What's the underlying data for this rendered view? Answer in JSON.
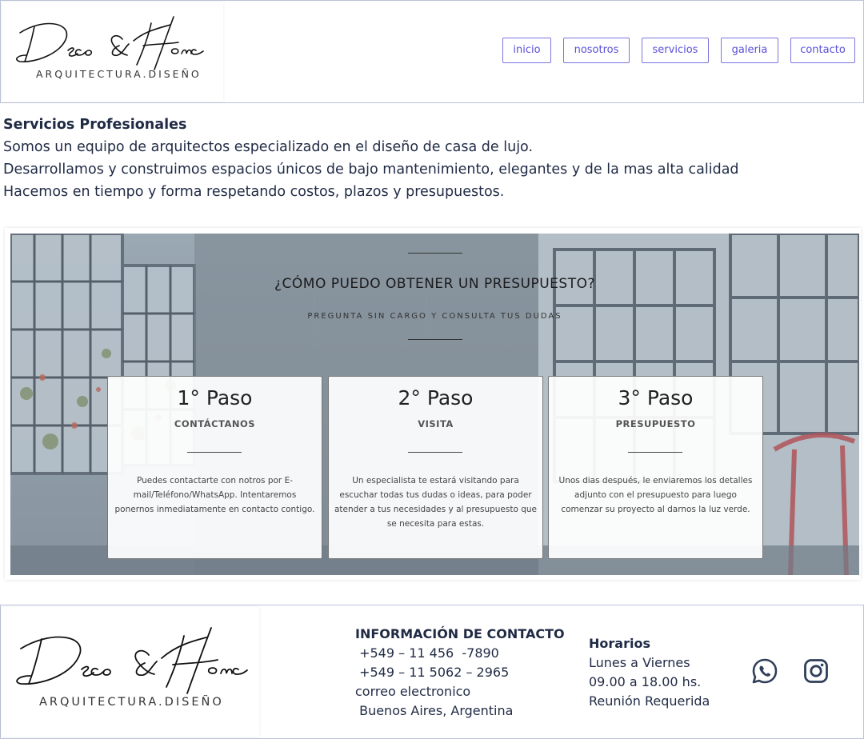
{
  "brand": {
    "logo_script": "Deco & Home",
    "logo_sub": "ARQUITECTURA.DISEÑO"
  },
  "nav": {
    "items": [
      {
        "label": "inicio"
      },
      {
        "label": "nosotros"
      },
      {
        "label": "servicios"
      },
      {
        "label": "galeria"
      },
      {
        "label": "contacto"
      }
    ]
  },
  "intro": {
    "heading": "Servicios Profesionales",
    "lines": [
      "Somos un equipo de arquitectos especializado en el diseño de casa de lujo.",
      "Desarrollamos y construimos espacios únicos de bajo mantenimiento, elegantes y de la mas alta calidad",
      "Hacemos en tiempo y forma respetando costos, plazos y presupuestos."
    ]
  },
  "banner": {
    "title": "¿CÓMO PUEDO OBTENER UN PRESUPUESTO?",
    "subtitle": "PREGUNTA SIN CARGO Y CONSULTA TUS DUDAS",
    "steps": [
      {
        "title": "1° Paso",
        "subtitle": "CONTÁCTANOS",
        "text": "Puedes contactarte con notros por E-mail/Teléfono/WhatsApp. Intentaremos ponernos inmediatamente en contacto contigo."
      },
      {
        "title": "2° Paso",
        "subtitle": "VISITA",
        "text": "Un especialista te estará visitando para escuchar todas tus dudas o ideas, para poder atender a tus necesidades y al presupuesto que se necesita para estas."
      },
      {
        "title": "3° Paso",
        "subtitle": "PRESUPUESTO",
        "text": "Unos dias después, le enviaremos los detalles adjunto con el presupuesto para luego comenzar su proyecto al darnos la luz verde."
      }
    ]
  },
  "footer": {
    "contact": {
      "heading": "INFORMACIÓN DE CONTACTO",
      "phone1": " +549 – 11 456  -7890",
      "phone2": " +549 – 11 5062 – 2965",
      "email": "correo electronico",
      "location": " Buenos Aires, Argentina"
    },
    "hours": {
      "heading": "Horarios",
      "days": "Lunes a Viernes",
      "time": "09.00 a 18.00 hs.",
      "note": "Reunión Requerida"
    },
    "social": [
      {
        "icon": "whatsapp-icon"
      },
      {
        "icon": "instagram-icon"
      }
    ]
  },
  "colors": {
    "nav_border": "#7b74e0",
    "nav_text": "#5a50d8",
    "text_dark": "#1f2a44",
    "social_icon": "#2f3f5a"
  }
}
